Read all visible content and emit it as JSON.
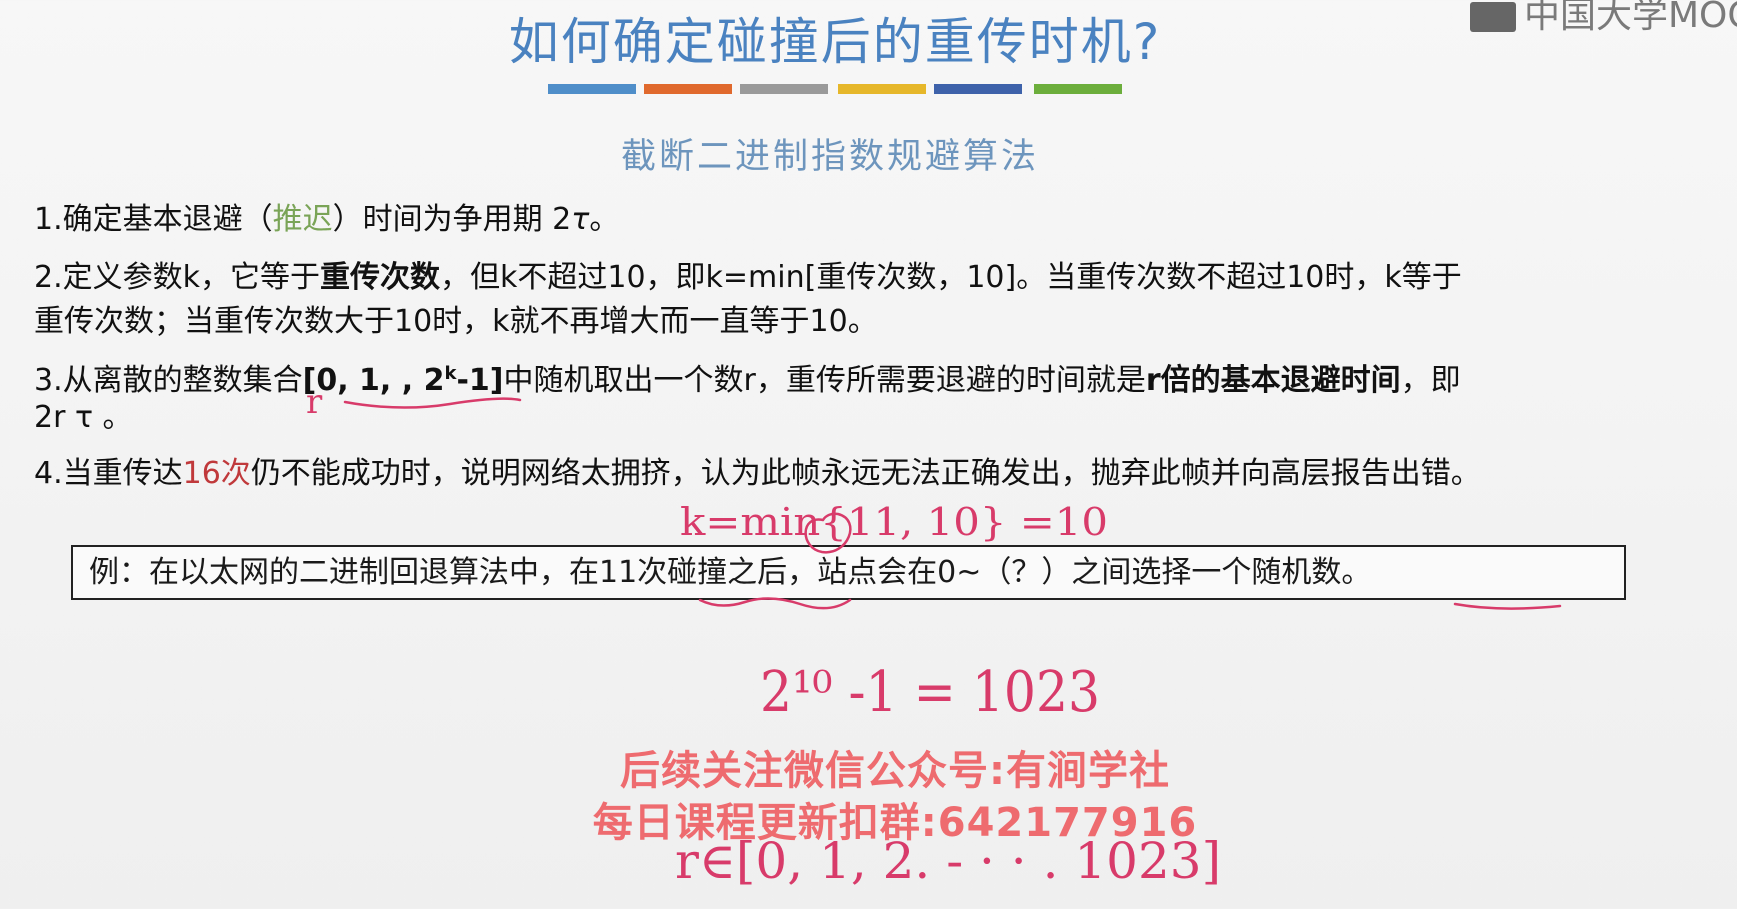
{
  "header": {
    "title": "如何确定碰撞后的重传时机?",
    "logo_text": "中国大学MOOC",
    "color_bars": [
      "#4f8ec9",
      "#e0692d",
      "#9a9a9a",
      "#e6b72a",
      "#3e62aa",
      "#6cae3c"
    ]
  },
  "subtitle": "截断二进制指数规避算法",
  "rules": {
    "r1": {
      "a": "1.确定基本退避（",
      "green": "推迟",
      "b": "）时间为争用期 2",
      "tau": "τ",
      "c": "。"
    },
    "r2": {
      "a": "2.定义参数k，它等于",
      "bold": "重传次数",
      "b": "，但k不超过10，即k=min[重传次数，10]。当重传次数不超过10时，k等于",
      "line2": "重传次数；当重传次数大于10时，k就不再增大而一直等于10。"
    },
    "r3": {
      "a": "3.从离散的整数集合",
      "set_a": "[0, 1, , 2",
      "sup": "k",
      "set_b": "-1]",
      "b": "中随机取出一个数r，重传所需要退避的时间就是",
      "bold2": "r倍的基本退避时间",
      "c": "，即",
      "line2": "2r τ 。"
    },
    "r4": {
      "a": "4.当重传达",
      "red": "16次",
      "b": "仍不能成功时，说明网络太拥挤，认为此帧永远无法正确发出，抛弃此帧并向高层报告出错。"
    }
  },
  "example": "例：在以太网的二进制回退算法中，在11次碰撞之后，站点会在0~（？）之间选择一个随机数。",
  "watermark": {
    "line1": "后续关注微信公众号:有涧学社",
    "line2": "每日课程更新扣群:642177916"
  },
  "handwriting": {
    "kmin": "k=min{11, 10} =10",
    "power": "2¹⁰ -1 = 1023",
    "r_in": "r∈[0, 1, 2. -  ·  · . 1023]",
    "r_mark": "r"
  }
}
